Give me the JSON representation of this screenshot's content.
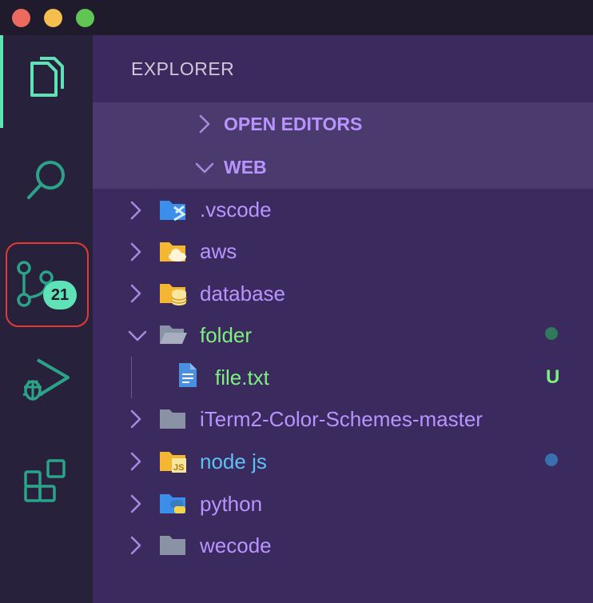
{
  "window": {
    "traffic_lights": [
      "close",
      "minimize",
      "zoom"
    ]
  },
  "activity_bar": {
    "items": [
      {
        "icon": "files-icon",
        "active": true
      },
      {
        "icon": "search-icon"
      },
      {
        "icon": "source-control-icon",
        "badge": "21"
      },
      {
        "icon": "run-debug-icon"
      },
      {
        "icon": "extensions-icon"
      }
    ]
  },
  "explorer": {
    "title": "EXPLORER",
    "open_editors": "OPEN EDITORS",
    "workspace": "WEB",
    "items": [
      {
        "name": ".vscode",
        "icon": "vscode-folder-icon"
      },
      {
        "name": "aws",
        "icon": "aws-folder-icon"
      },
      {
        "name": "database",
        "icon": "database-folder-icon"
      },
      {
        "name": "folder",
        "icon": "open-folder-icon",
        "expanded": true
      },
      {
        "name": "file.txt",
        "icon": "text-file-icon",
        "status": "U"
      },
      {
        "name": "iTerm2-Color-Schemes-master",
        "icon": "folder-icon"
      },
      {
        "name": "node js",
        "icon": "nodejs-folder-icon"
      },
      {
        "name": "python",
        "icon": "python-folder-icon"
      },
      {
        "name": "wecode",
        "icon": "folder-icon"
      }
    ]
  },
  "colors": {
    "accent": "#5fe2b5",
    "folder_label": "#b994ff",
    "untracked": "#7ef07e",
    "modified_dot": "#2f7a5b",
    "node_dot": "#3a6fb0",
    "highlight": "#e53935"
  }
}
